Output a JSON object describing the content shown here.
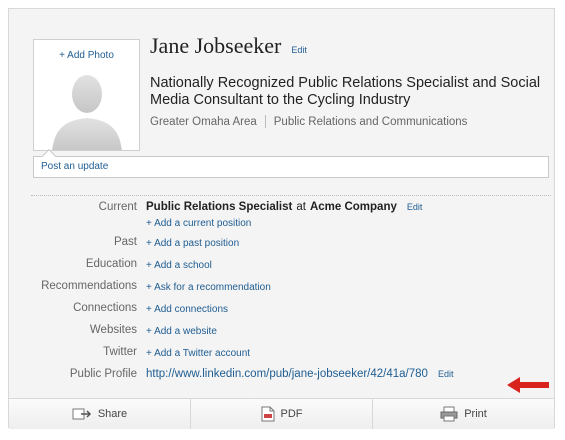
{
  "profile": {
    "add_photo": "+ Add Photo",
    "name": "Jane Jobseeker",
    "edit_label": "Edit",
    "headline": "Nationally Recognized Public Relations Specialist and Social Media Consultant to the Cycling Industry",
    "location": "Greater Omaha Area",
    "industry": "Public Relations and Communications",
    "post_update": "Post an update"
  },
  "details": {
    "current": {
      "label": "Current",
      "title": "Public Relations Specialist",
      "at": "at",
      "company": "Acme Company",
      "edit": "Edit",
      "add": "+ Add a current position"
    },
    "past": {
      "label": "Past",
      "value": "+ Add a past position"
    },
    "education": {
      "label": "Education",
      "value": "+ Add a school"
    },
    "recommendations": {
      "label": "Recommendations",
      "value": "+ Ask for a recommendation"
    },
    "connections": {
      "label": "Connections",
      "value": "+ Add connections"
    },
    "websites": {
      "label": "Websites",
      "value": "+ Add a website"
    },
    "twitter": {
      "label": "Twitter",
      "value": "+ Add a Twitter account"
    },
    "public_profile": {
      "label": "Public Profile",
      "url": "http://www.linkedin.com/pub/jane-jobseeker/42/41a/780",
      "edit": "Edit"
    }
  },
  "actions": {
    "share": "Share",
    "pdf": "PDF",
    "print": "Print"
  },
  "colors": {
    "link": "#1f5d92",
    "arrow": "#d9231d"
  }
}
